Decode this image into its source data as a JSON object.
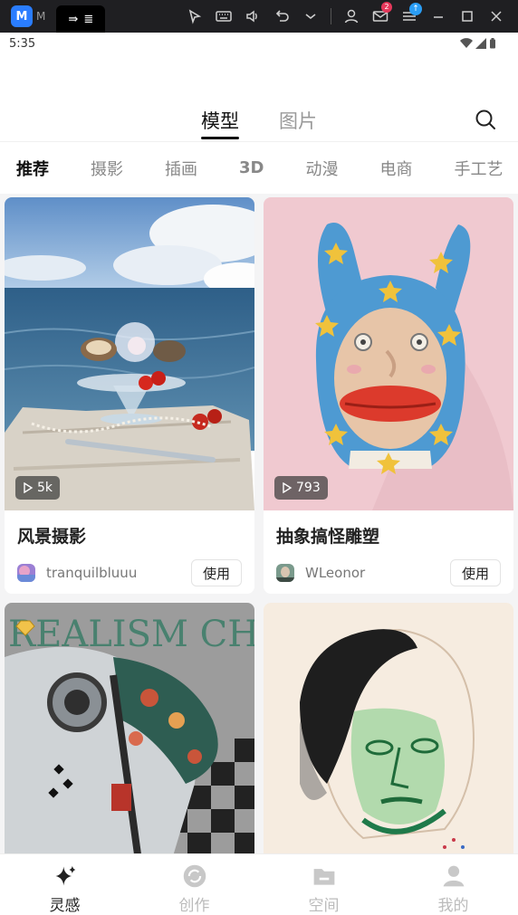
{
  "emulator": {
    "app_label": "M",
    "tab_label": "≣",
    "mail_badge": "2",
    "update_badge": "↑"
  },
  "status": {
    "time": "5:35"
  },
  "top_tabs": [
    {
      "label": "模型",
      "active": true
    },
    {
      "label": "图片",
      "active": false
    }
  ],
  "categories": [
    "推荐",
    "摄影",
    "插画",
    "3D",
    "动漫",
    "电商",
    "手工艺"
  ],
  "cards": [
    {
      "title": "风景摄影",
      "author": "tranquilbluuu",
      "plays": "5k",
      "use_label": "使用"
    },
    {
      "title": "抽象搞怪雕塑",
      "author": "WLeonor",
      "plays": "793",
      "use_label": "使用"
    },
    {
      "art_text": "REALISM CHESS"
    },
    {}
  ],
  "bottom_nav": [
    {
      "label": "灵感",
      "icon": "sparkle-icon",
      "active": true
    },
    {
      "label": "创作",
      "icon": "create-icon",
      "active": false
    },
    {
      "label": "空间",
      "icon": "folder-icon",
      "active": false
    },
    {
      "label": "我的",
      "icon": "profile-icon",
      "active": false
    }
  ],
  "colors": {
    "accent": "#111111",
    "inactive": "#999999",
    "emulator_bg": "#1f1f22"
  }
}
